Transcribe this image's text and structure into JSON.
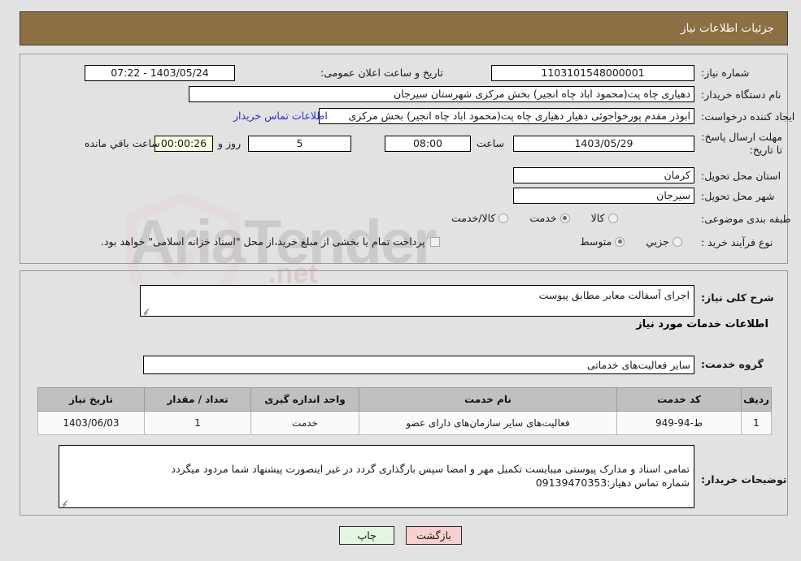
{
  "header": {
    "title": "جزئیات اطلاعات نیاز"
  },
  "top": {
    "need_number_label": "شماره نیاز:",
    "need_number_value": "1103101548000001",
    "public_announce_label": "تاریخ و ساعت اعلان عمومی:",
    "public_announce_value": "1403/05/24 - 07:22",
    "buyer_org_label": "نام دستگاه خریدار:",
    "buyer_org_value": "دهیاری چاه پت(محمود اباد چاه انجیر) بخش مرکزی شهرستان سیرجان",
    "requester_label": "ایجاد کننده درخواست:",
    "requester_value": "ابوذر مقدم پورخواجوئی دهیار دهیاری چاه پت(محمود اباد چاه انجیر) بخش مرکزی",
    "contact_link": "اطلاعات تماس خریدار",
    "deadline_label": "مهلت ارسال پاسخ: تا تاریخ:",
    "deadline_date": "1403/05/29",
    "hour_label": "ساعت",
    "deadline_time": "08:00",
    "days_remaining": "5",
    "days_word": "روز و",
    "countdown": "00:00:26",
    "countdown_suffix": "ساعت باقي مانده",
    "province_label": "استان محل تحویل:",
    "province_value": "کرمان",
    "city_label": "شهر محل تحویل:",
    "city_value": "سیرجان",
    "category_label": "طبقه بندی موضوعی:",
    "category_options": [
      {
        "label": "کالا",
        "selected": false
      },
      {
        "label": "خدمت",
        "selected": true
      },
      {
        "label": "کالا/خدمت",
        "selected": false
      }
    ],
    "process_label": "نوع فرآیند خرید :",
    "process_options": [
      {
        "label": "جزیي",
        "selected": false
      },
      {
        "label": "متوسط",
        "selected": true
      }
    ],
    "treasury_checkbox_text": "پرداخت تمام یا بخشی از مبلغ خرید،از محل \"اسناد خزانه اسلامی\" خواهد بود."
  },
  "bottom": {
    "general_desc_label": "شرح کلی نیاز:",
    "general_desc_value": "اجرای آسفالت معابر مطابق پیوست",
    "services_section_title": "اطلاعات خدمات مورد نیاز",
    "service_group_label": "گروه خدمت:",
    "service_group_value": "سایر فعالیت‌های خدماتی",
    "table": {
      "columns": [
        "ردیف",
        "کد خدمت",
        "نام خدمت",
        "واحد اندازه گیری",
        "تعداد / مقدار",
        "تاریخ نیاز"
      ],
      "rows": [
        [
          "1",
          "ط-94-949",
          "فعالیت‌های سایر سازمان‌های دارای عضو",
          "خدمت",
          "1",
          "1403/06/03"
        ]
      ]
    },
    "buyer_notes_label": "توضیحات خریدار:",
    "buyer_notes_value": "تمامی اسناد و مدارک پیوستی میبایست تکمیل مهر و امضا سپس بارگذاری گردد در غیر اینصورت پیشنهاد شما مردود میگردد\nشماره تماس دهیار:09139470353"
  },
  "footer": {
    "print_label": "چاپ",
    "back_label": "بازگشت"
  },
  "watermark": {
    "text": "AriaTender",
    "text2": ".net"
  },
  "colors": {
    "header_bg": "#8c6f42",
    "link": "#2b2bd4",
    "countdown_bg": "#fbfbe4",
    "print_bg": "#e6f5e2",
    "back_bg": "#f9cfcf",
    "table_header_bg": "#c0c0c0"
  }
}
